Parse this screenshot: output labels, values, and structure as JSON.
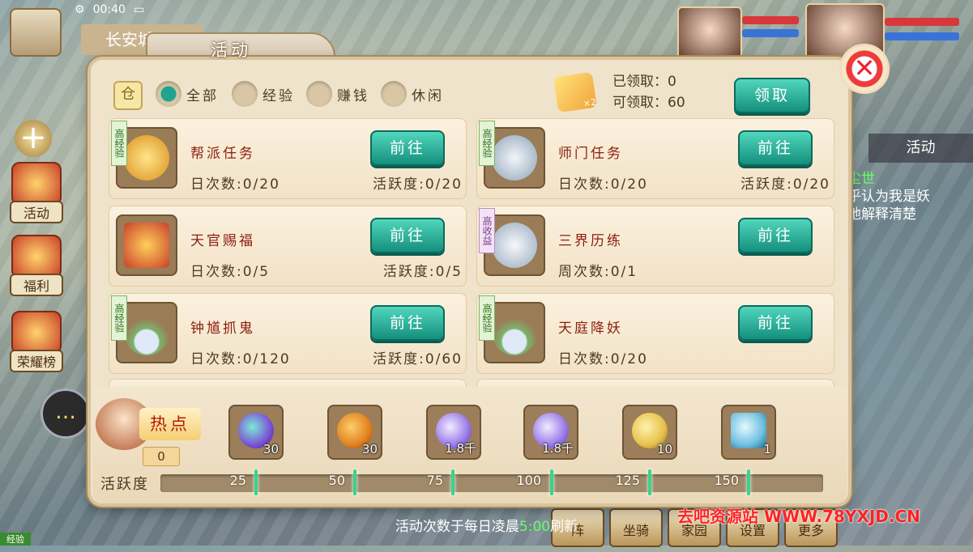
{
  "hud": {
    "time": "00:40",
    "city_label": "长安城",
    "side_buttons": [
      {
        "label": "活动",
        "icon": "horn-icon"
      },
      {
        "label": "福利",
        "icon": "gift-icon"
      },
      {
        "label": "荣耀榜",
        "icon": "ranking-icon"
      }
    ],
    "plus_glyph": "+",
    "chat_glyph": "…",
    "right_tab": "活动",
    "right_chat": [
      "尘世",
      "乎认为我是妖",
      "地解释清楚"
    ],
    "bottom_buttons": [
      "阵",
      "坐骑",
      "家园",
      "设置",
      "更多"
    ],
    "exp_tag": "经验"
  },
  "dialog": {
    "title": "活动",
    "close_glyph": "✕",
    "filter_icon_glyph": "仓",
    "filters": [
      {
        "label": "全部",
        "selected": true
      },
      {
        "label": "经验",
        "selected": false
      },
      {
        "label": "赚钱",
        "selected": false
      },
      {
        "label": "休闲",
        "selected": false
      }
    ],
    "claim": {
      "multiplier": "×2",
      "claimed_label": "已领取：",
      "claimed_value": "0",
      "available_label": "可领取：",
      "available_value": "60",
      "button": "领取"
    },
    "activities": [
      {
        "name": "帮派任务",
        "badge": "高经验",
        "badge_type": "green",
        "count": "日次数:0/20",
        "active": "活跃度:0/20",
        "go": "前往",
        "icon_color": "#f2b23a"
      },
      {
        "name": "师门任务",
        "badge": "高经验",
        "badge_type": "green",
        "count": "日次数:0/20",
        "active": "活跃度:0/20",
        "go": "前往",
        "icon_color": "#c7d3de"
      },
      {
        "name": "天官赐福",
        "badge": "",
        "badge_type": "none",
        "count": "日次数:0/5",
        "active": "活跃度:0/5",
        "go": "前往",
        "icon_color": "#e8862f"
      },
      {
        "name": "三界历练",
        "badge": "高收益",
        "badge_type": "purple",
        "count": "周次数:0/1",
        "active": "",
        "go": "前往",
        "icon_color": "#b9c8d6"
      },
      {
        "name": "钟馗抓鬼",
        "badge": "高经验",
        "badge_type": "green",
        "count": "日次数:0/120",
        "active": "活跃度:0/60",
        "go": "前往",
        "icon_color": "#6fae5c"
      },
      {
        "name": "天庭降妖",
        "badge": "高经验",
        "badge_type": "green",
        "count": "日次数:0/20",
        "active": "",
        "go": "前往",
        "icon_color": "#6fae5c"
      }
    ],
    "hot": {
      "label": "热点",
      "value": "0"
    },
    "rewards": [
      {
        "qty": "30",
        "color": "#7b52d6",
        "icon": "spirit-orb-icon"
      },
      {
        "qty": "30",
        "color": "#e0821f",
        "icon": "pouch-icon"
      },
      {
        "qty": "1.8千",
        "color": "#9a7ae8",
        "icon": "silver-orb-icon"
      },
      {
        "qty": "1.8千",
        "color": "#9a7ae8",
        "icon": "silver-orb-icon"
      },
      {
        "qty": "10",
        "color": "#e7c14a",
        "icon": "key-icon"
      },
      {
        "qty": "1",
        "color": "#6ec0e0",
        "icon": "ticket-icon"
      }
    ],
    "progress": {
      "label": "活跃度",
      "value": 0,
      "max": 150,
      "milestones": [
        "25",
        "50",
        "75",
        "100",
        "125",
        "150"
      ]
    },
    "footer": {
      "prefix": "活动次数于每日凌晨",
      "time": "5:00",
      "suffix": "刷新"
    }
  },
  "watermark": "去吧资源站 WWW.78YXJD.CN",
  "colors": {
    "accent_teal": "#1fa58d",
    "title_red": "#8b1e10",
    "panel_bg": "#efe3cb"
  }
}
